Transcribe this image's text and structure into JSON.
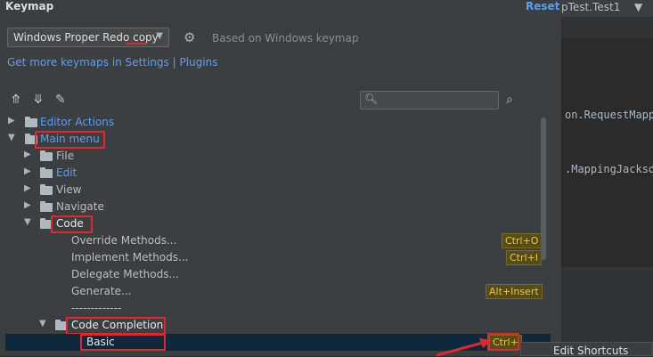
{
  "window": {
    "title": "Keymap",
    "reset_label": "Reset"
  },
  "editor": {
    "run_config": "pTest.Test1",
    "code_lines": [
      "on.RequestMapp",
      ".MappingJackso"
    ]
  },
  "keymap_selector": {
    "value": "Windows Proper Redo copy",
    "based_on": "Based on Windows keymap",
    "get_more": "Get more keymaps in Settings | Plugins"
  },
  "tree": {
    "editor_actions": "Editor Actions",
    "main_menu": "Main menu",
    "file": "File",
    "edit": "Edit",
    "view": "View",
    "navigate": "Navigate",
    "code": "Code",
    "override": {
      "label": "Override Methods...",
      "shortcut": "Ctrl+O"
    },
    "implement": {
      "label": "Implement Methods...",
      "shortcut": "Ctrl+I"
    },
    "delegate": {
      "label": "Delegate Methods..."
    },
    "generate": {
      "label": "Generate...",
      "shortcut": "Alt+Insert"
    },
    "separator": "-------------",
    "code_completion": "Code Completion",
    "basic": {
      "label": "Basic",
      "shortcut": "Ctrl+"
    }
  },
  "context_menu": {
    "edit_shortcuts": "Edit Shortcuts"
  },
  "colors": {
    "accent": "#589df6",
    "highlight_red": "#e0272b",
    "selection": "#0d293e"
  }
}
